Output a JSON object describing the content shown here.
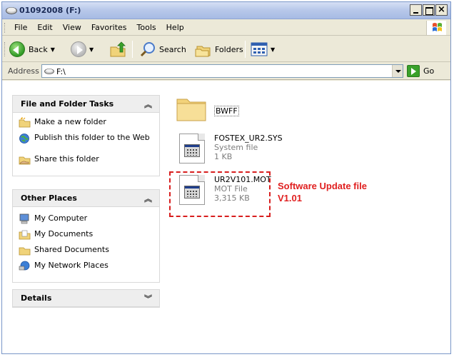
{
  "window": {
    "title": "01092008 (F:)"
  },
  "menu": {
    "items": [
      "File",
      "Edit",
      "View",
      "Favorites",
      "Tools",
      "Help"
    ]
  },
  "toolbar": {
    "back_label": "Back",
    "search_label": "Search",
    "folders_label": "Folders"
  },
  "address": {
    "label": "Address",
    "value": "F:\\",
    "go_label": "Go"
  },
  "taskpane": {
    "file_tasks": {
      "title": "File and Folder Tasks",
      "items": [
        {
          "label": "Make a new folder",
          "icon": "new-folder-icon"
        },
        {
          "label": "Publish this folder to the Web",
          "icon": "publish-web-icon"
        },
        {
          "label": "Share this folder",
          "icon": "share-folder-icon"
        }
      ]
    },
    "other_places": {
      "title": "Other Places",
      "items": [
        {
          "label": "My Computer",
          "icon": "computer-icon"
        },
        {
          "label": "My Documents",
          "icon": "documents-icon"
        },
        {
          "label": "Shared Documents",
          "icon": "shared-folder-icon"
        },
        {
          "label": "My Network Places",
          "icon": "network-icon"
        }
      ]
    },
    "details": {
      "title": "Details"
    }
  },
  "files": [
    {
      "name": "BWFF",
      "type": "",
      "size": "",
      "icon": "folder-icon"
    },
    {
      "name": "FOSTEX_UR2.SYS",
      "type": "System file",
      "size": "1 KB",
      "icon": "system-file-icon"
    },
    {
      "name": "UR2V101.MOT",
      "type": "MOT File",
      "size": "3,315 KB",
      "icon": "mot-file-icon"
    }
  ],
  "annotation": {
    "line1": "Software Update file",
    "line2": "V1.01",
    "color": "#e02020"
  },
  "colors": {
    "titlebar": "#b9c9ea",
    "chrome": "#ece9d8",
    "accent_red": "#d81e1e"
  }
}
